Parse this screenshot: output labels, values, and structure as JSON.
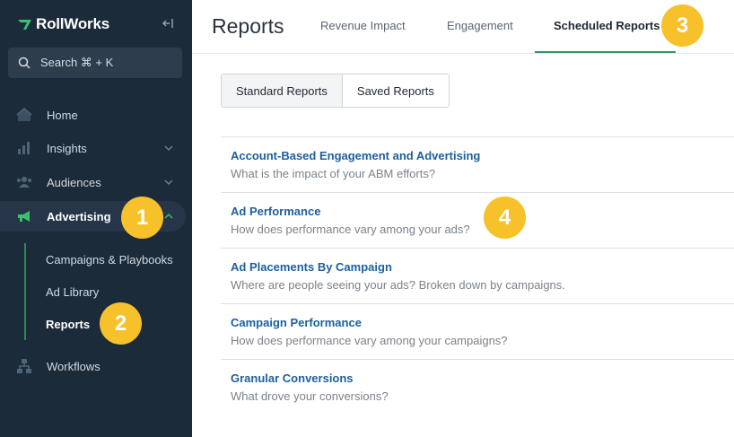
{
  "app": {
    "brand": "RollWorks",
    "brand_color": "#2e9a5c"
  },
  "sidebar": {
    "search_label": "Search ⌘ + K",
    "items": [
      {
        "label": "Home",
        "icon": "home-icon"
      },
      {
        "label": "Insights",
        "icon": "insights-icon"
      },
      {
        "label": "Audiences",
        "icon": "audiences-icon"
      },
      {
        "label": "Advertising",
        "icon": "megaphone-icon"
      },
      {
        "label": "Workflows",
        "icon": "workflows-icon"
      }
    ],
    "subitems": [
      {
        "label": "Campaigns & Playbooks"
      },
      {
        "label": "Ad Library"
      },
      {
        "label": "Reports"
      }
    ]
  },
  "header": {
    "title": "Reports",
    "tabs": [
      {
        "label": "Revenue Impact"
      },
      {
        "label": "Engagement"
      },
      {
        "label": "Scheduled Reports"
      }
    ]
  },
  "segment": {
    "standard": "Standard Reports",
    "saved": "Saved Reports"
  },
  "reports": [
    {
      "title": "Account-Based Engagement and Advertising",
      "desc": "What is the impact of your ABM efforts?"
    },
    {
      "title": "Ad Performance",
      "desc": "How does performance vary among your ads?"
    },
    {
      "title": "Ad Placements By Campaign",
      "desc": "Where are people seeing your ads? Broken down by campaigns."
    },
    {
      "title": "Campaign Performance",
      "desc": "How does performance vary among your campaigns?"
    },
    {
      "title": "Granular Conversions",
      "desc": "What drove your conversions?"
    }
  ],
  "annotations": {
    "b1": "1",
    "b2": "2",
    "b3": "3",
    "b4": "4",
    "color": "#f6c12a"
  }
}
